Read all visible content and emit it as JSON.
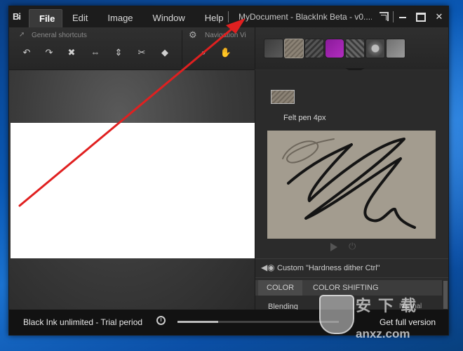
{
  "app": {
    "logo": "Bi",
    "menu": [
      {
        "label": "File",
        "active": true
      },
      {
        "label": "Edit"
      },
      {
        "label": "Image"
      },
      {
        "label": "Window"
      },
      {
        "label": "Help"
      }
    ],
    "document_title": "MyDocument - BlackInk Beta - v0...."
  },
  "toolbar": {
    "general_shortcuts_label": "General shortcuts",
    "navigation_label": "Navigation Vi",
    "tools": [
      {
        "icon": "undo-icon",
        "glyph": "↶"
      },
      {
        "icon": "redo-icon",
        "glyph": "↷"
      },
      {
        "icon": "delete-icon",
        "glyph": "✖"
      },
      {
        "icon": "flip-horizontal-icon",
        "glyph": "⇔"
      },
      {
        "icon": "flip-vertical-icon",
        "glyph": "⇕"
      },
      {
        "icon": "cut-icon",
        "glyph": "✂"
      },
      {
        "icon": "fill-icon",
        "glyph": "◆"
      },
      {
        "icon": "zoom-icon",
        "glyph": "⌕"
      },
      {
        "icon": "pan-hand-icon",
        "glyph": "✋"
      }
    ]
  },
  "brushes": [
    "brush-tip",
    "felt-pen",
    "dark-stroke",
    "purple-blob",
    "hatch-stroke",
    "swirl-brush",
    "eraser"
  ],
  "brush_panel": {
    "selected_brush_name": "Felt pen 4px",
    "parameter_label": "Custom \"Hardness dither Ctrl\"",
    "tabs": [
      "COLOR",
      "COLOR SHIFTING"
    ],
    "blending_label": "Blending",
    "blending_value": "Normal"
  },
  "status": {
    "trial_text": "Black Ink unlimited - Trial period",
    "trial_progress": 0.25,
    "get_full_label": "Get full version"
  },
  "watermark": {
    "text": "安下载",
    "url": "anxz.com"
  },
  "colors": {
    "accent_purple": "#b22dbf",
    "annotation_red": "#e02020",
    "preview_bg": "#a39c8f"
  }
}
